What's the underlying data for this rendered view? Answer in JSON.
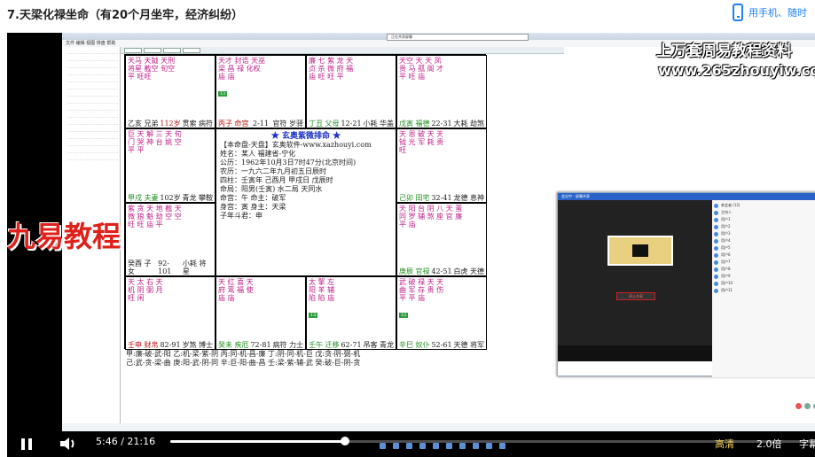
{
  "header": {
    "title": "7.天梁化禄坐命（有20个月坐牢，经济纠纷）",
    "phone_link": "用手机、随时"
  },
  "watermark": {
    "line1": "上万套周易教程资料",
    "line2": "www.265zhouyiw.com",
    "brand": "九易教程"
  },
  "software": {
    "dialog_text": "正在共享屏幕",
    "menu_text": "文件 编辑 视图 排盘 帮助"
  },
  "palaces": [
    {
      "stars": "天马 天鉞 天刑\n将星 截空 旬空\n平 旺旺",
      "color": "magenta",
      "badge": "",
      "foot_left": "乙亥 兄弟",
      "foot_mid": "112岁",
      "foot_right": "贯索 病符"
    },
    {
      "stars": "天才 封诰 天巫\n梁 昌 禄 化权\n庙 庙",
      "color": "magenta",
      "badge": "13",
      "foot_left": "丙子 命宫",
      "foot_mid": "2-11",
      "foot_right": "官符 岁驿"
    },
    {
      "stars": "廉 七 紫 龙 天\n贞 杀 微 府 福\n庙 旺 旺 平",
      "color": "magenta",
      "badge": "",
      "foot_left": "丁丑 父母",
      "foot_mid": "12-21",
      "foot_right": "小耗 华盖"
    },
    {
      "stars": "天空 天 天 凤\n贵 马 孤 阁 才\n平 旺 庙",
      "color": "magenta",
      "badge": "",
      "foot_left": "戊寅 福德",
      "foot_mid": "22-31",
      "foot_right": "大耗 劫煞"
    },
    {
      "stars": "巨 天 解 三 天 旬\n门 哭 神 台 姚 空\n平 平",
      "color": "magenta",
      "badge": "",
      "foot_left": "甲戌 夫妻",
      "foot_mid": "102岁",
      "foot_right": "青龙 攀鞍"
    },
    {
      "stars": "天 恩 破 天 天\n钺 光 军 耗 贵\n旺",
      "color": "magenta",
      "badge": "",
      "foot_left": "己卯 田宅",
      "foot_mid": "32-41",
      "foot_right": "龙德 息神"
    },
    {
      "stars": "紫 贪 天 地 截 天\n微 狼 魁 劫 空 空\n旺 旺 庙 平",
      "color": "magenta",
      "badge": "",
      "foot_left": "癸酉 子女",
      "foot_mid": "92-101",
      "foot_right": "小耗 将星"
    },
    {
      "stars": "天 阳 台 阴 八 天 蜚\n同 罗 辅 煞 座 官 廉\n平 庙",
      "color": "magenta",
      "badge": "",
      "foot_left": "庚辰 官禄",
      "foot_mid": "42-51",
      "foot_right": "白虎 天德"
    },
    {
      "stars": "天 太 右 天\n机 阴 弼 月\n旺 闲",
      "color": "magenta",
      "badge": "",
      "foot_left": "壬申 财帛",
      "foot_mid": "82-91",
      "foot_right": "岁煞 博士"
    },
    {
      "stars": "天 红 喜 天\n府 鸾 福 使\n庙 庙",
      "color": "magenta",
      "badge": "",
      "foot_left": "癸未 疾厄",
      "foot_mid": "72-81",
      "foot_right": "病符 力士"
    },
    {
      "stars": "太 擎 左\n阳 羊 辅\n陷 陷 庙",
      "color": "magenta",
      "badge": "13",
      "foot_left": "壬午 迁移",
      "foot_mid": "62-71",
      "foot_right": "吊客 青龙"
    },
    {
      "stars": "武 破 禄 天 天\n曲 军 存 贵 伤\n平 平 庙",
      "color": "magenta",
      "badge": "12",
      "foot_left": "辛巳 奴仆",
      "foot_mid": "52-61",
      "foot_right": "天德 将军"
    }
  ],
  "center": {
    "title": "★ 玄奥紫微排命 ★",
    "lines": [
      "【本命盘-天盘】玄奥软件-www.xazhouyi.com",
      "姓名：某人 福建省-宁化",
      "公历：1962年10月3日7时47分(北京时间)",
      "农历：一九六二年九月初五日辰时",
      "四柱：壬寅年 己酉月 甲戌日 戊辰时",
      "命局：阳男(壬寅)  水二局 天同水",
      "命宫：午      命主：破军",
      "身宫：寅      身主：天梁",
      "子年斗君：申"
    ]
  },
  "bottom": {
    "line1": "甲:廉-破-武-阳  乙:机-梁-紫-阴  丙:同-机-昌-廉  丁:阴-同-机-巨  戊:贪-阴-弼-机",
    "line2": "己:武-贪-梁-曲  庚:阳-武-阴-同  辛:巨-阳-曲-昌  壬:梁-紫-辅-武  癸:破-巨-阴-贪"
  },
  "meeting": {
    "title": "会议中 - 屏幕共享",
    "stop_label": "停止共享",
    "participants": [
      "参会者 (12)",
      "主持人",
      "用户1",
      "用户2",
      "用户3",
      "用户4",
      "用户5",
      "用户6",
      "用户7",
      "用户8",
      "用户9",
      "用户10",
      "用户11"
    ]
  },
  "player": {
    "current_time": "5:46",
    "separator": "/",
    "duration": "21:16",
    "progress": 0.271,
    "quality": "高清",
    "speed": "2.0倍",
    "subtitle": "字幕"
  }
}
